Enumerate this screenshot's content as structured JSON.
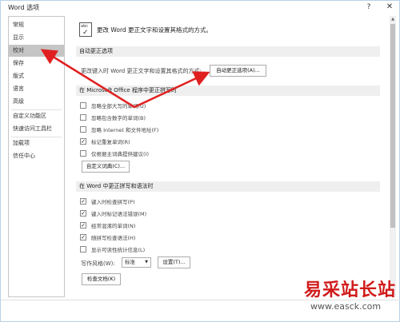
{
  "window": {
    "title": "Word 选项",
    "help": "?",
    "close": "✕"
  },
  "sidebar": {
    "items": [
      {
        "label": "常规"
      },
      {
        "label": "显示"
      },
      {
        "label": "校对"
      },
      {
        "label": "保存"
      },
      {
        "label": "版式"
      },
      {
        "label": "语言"
      },
      {
        "label": "高级"
      },
      {
        "label": "自定义功能区"
      },
      {
        "label": "快速访问工具栏"
      },
      {
        "label": "加载项"
      },
      {
        "label": "信任中心"
      }
    ],
    "selected": "校对"
  },
  "header": {
    "icon_text": "abc",
    "text": "更改 Word 更正文字和设置其格式的方式。"
  },
  "autocorrect": {
    "title": "自动更正选项",
    "desc": "更改键入时 Word 更正文字和设置其格式的方式:",
    "button": "自动更正选项(A)..."
  },
  "office": {
    "title": "在 Microsoft Office 程序中更正拼写时",
    "options": [
      {
        "label": "忽略全部大写的单词(U)",
        "checked": false
      },
      {
        "label": "忽略包含数字的单词(B)",
        "checked": false
      },
      {
        "label": "忽略 Internet 和文件地址(F)",
        "checked": false
      },
      {
        "label": "标记重复单词(R)",
        "checked": true
      },
      {
        "label": "仅根据主词典提供建议(I)",
        "checked": false
      }
    ],
    "dict_button": "自定义词典(C)..."
  },
  "word": {
    "title": "在 Word 中更正拼写和语法时",
    "options": [
      {
        "label": "键入时检查拼写(P)",
        "checked": true
      },
      {
        "label": "键入时标记语法错误(M)",
        "checked": true
      },
      {
        "label": "经常混淆的单词(N)",
        "checked": true
      },
      {
        "label": "随拼写检查语法(H)",
        "checked": true
      },
      {
        "label": "显示可读性统计信息(L)",
        "checked": false
      }
    ],
    "style_label": "写作风格(W):",
    "style_value": "标准",
    "settings_button": "设置(T)...",
    "check_button": "检查文档(K)"
  },
  "watermark": {
    "text": "易采站长站",
    "url": "www.easck.com"
  },
  "colors": {
    "arrow": "#e02020",
    "selected_item": "#c5c5c5",
    "section_bg": "#efefef",
    "watermark": "#d11a1a"
  }
}
